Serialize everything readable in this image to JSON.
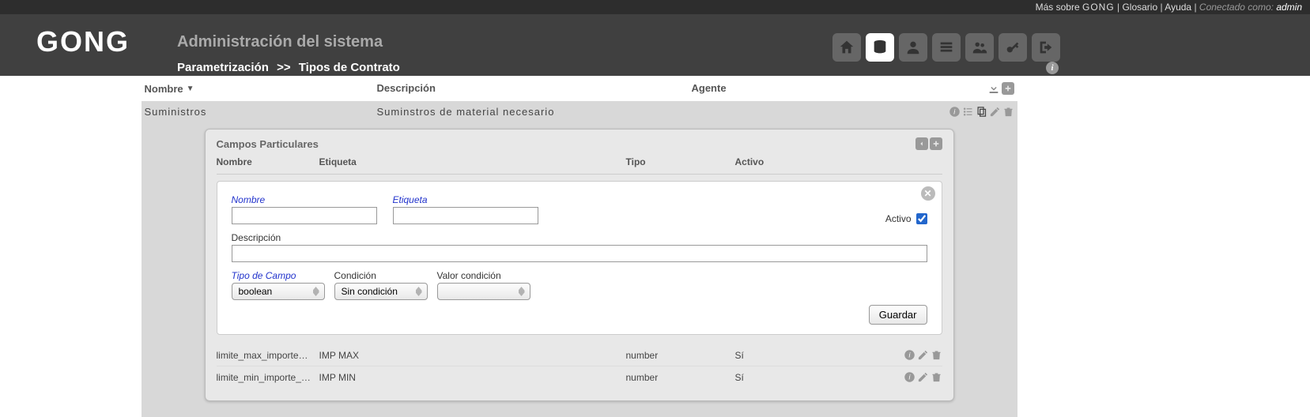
{
  "topbar": {
    "more": "Más sobre",
    "brand": "GONG",
    "glossary": "Glosario",
    "help": "Ayuda",
    "connected_as": "Conectado como:",
    "user": "admin"
  },
  "header": {
    "logo": "GONG",
    "title": "Administración del sistema",
    "breadcrumb1": "Parametrización",
    "sep": ">>",
    "breadcrumb2": "Tipos de Contrato"
  },
  "columns": {
    "nombre": "Nombre",
    "descripcion": "Descripción",
    "agente": "Agente"
  },
  "row": {
    "nombre": "Suministros",
    "descripcion": "Suminstros de material necesario"
  },
  "panel": {
    "title": "Campos Particulares",
    "cols": {
      "nombre": "Nombre",
      "etiqueta": "Etiqueta",
      "tipo": "Tipo",
      "activo": "Activo"
    }
  },
  "form": {
    "labels": {
      "nombre": "Nombre",
      "etiqueta": "Etiqueta",
      "activo": "Activo",
      "descripcion": "Descripción",
      "tipo_campo": "Tipo de Campo",
      "condicion": "Condición",
      "valor_cond": "Valor condición"
    },
    "values": {
      "nombre": "",
      "etiqueta": "",
      "descripcion": "",
      "tipo_campo": "boolean",
      "condicion": "Sin condición",
      "valor_cond": ""
    },
    "activo_checked": true,
    "save": "Guardar"
  },
  "fields": [
    {
      "nombre": "limite_max_importe_con…",
      "etiqueta": "IMP MAX",
      "tipo": "number",
      "activo": "Sí"
    },
    {
      "nombre": "limite_min_importe_con…",
      "etiqueta": "IMP MIN",
      "tipo": "number",
      "activo": "Sí"
    }
  ]
}
